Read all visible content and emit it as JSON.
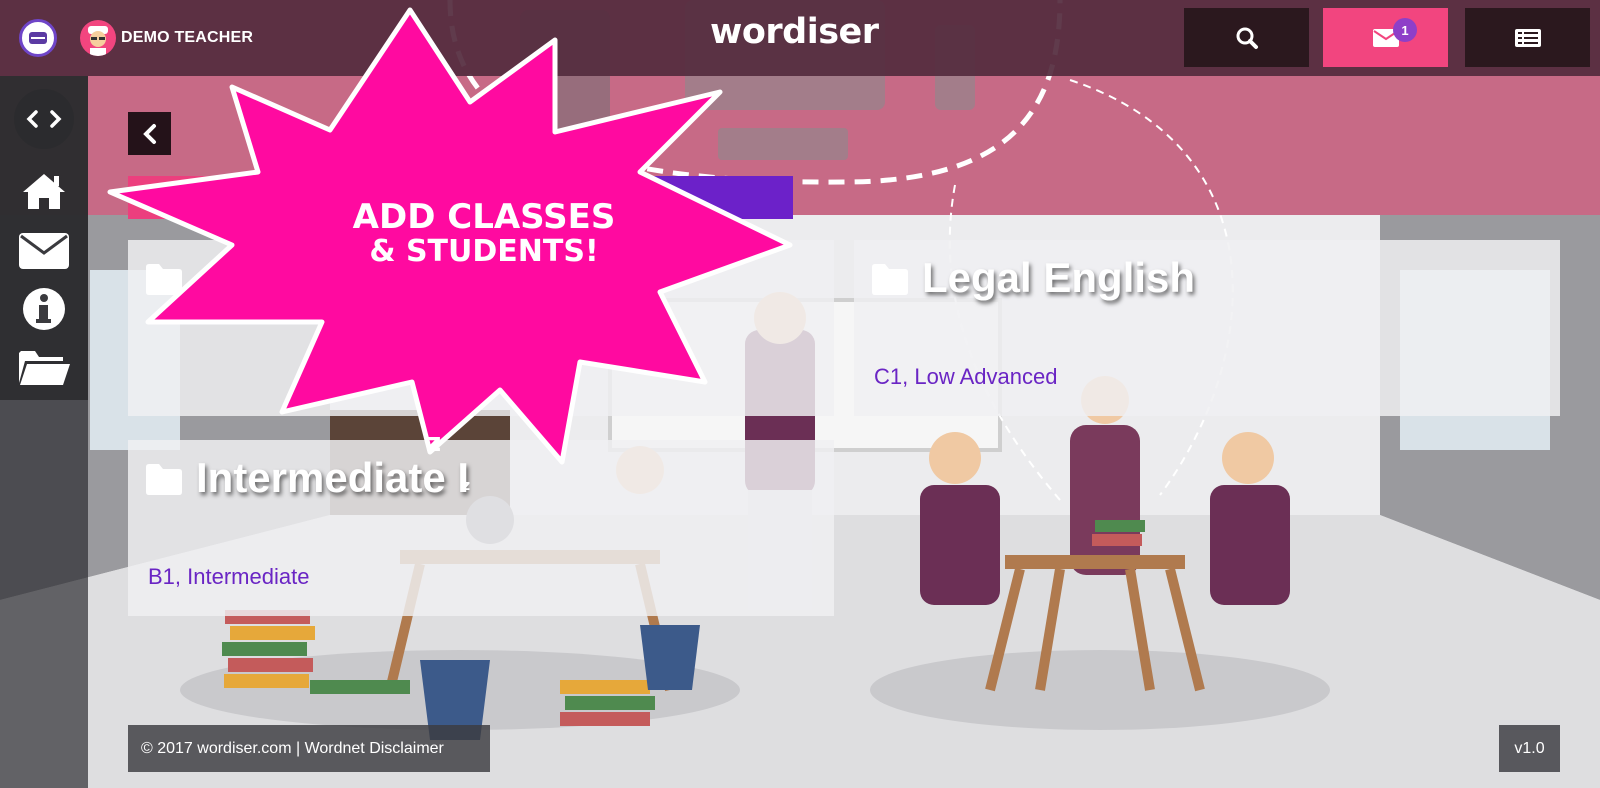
{
  "header": {
    "teacher_name": "DEMO TEACHER",
    "logo": "wordiser",
    "notification_count": "1",
    "icons": [
      "menu-icon",
      "search-icon",
      "mail-icon",
      "list-icon"
    ]
  },
  "sidebar": {
    "items": [
      {
        "icon": "code-toggle-icon"
      },
      {
        "icon": "home-icon"
      },
      {
        "icon": "mail-icon"
      },
      {
        "icon": "info-icon"
      },
      {
        "icon": "folder-open-icon"
      }
    ]
  },
  "classes": [
    {
      "name": "Legal English",
      "level": "C1, Low Advanced"
    },
    {
      "name": "Intermediate I",
      "level": "B1, Intermediate"
    }
  ],
  "promo": {
    "line1": "ADD CLASSES",
    "line2": "& STUDENTS!"
  },
  "footer": {
    "copyright": "© 2017 wordiser.com | Wordnet Disclaimer",
    "version": "v1.0"
  },
  "colors": {
    "brand_pink": "#f2457f",
    "purple": "#6c21c9",
    "starburst": "#ff0aa0",
    "topbar": "#542c3e"
  }
}
